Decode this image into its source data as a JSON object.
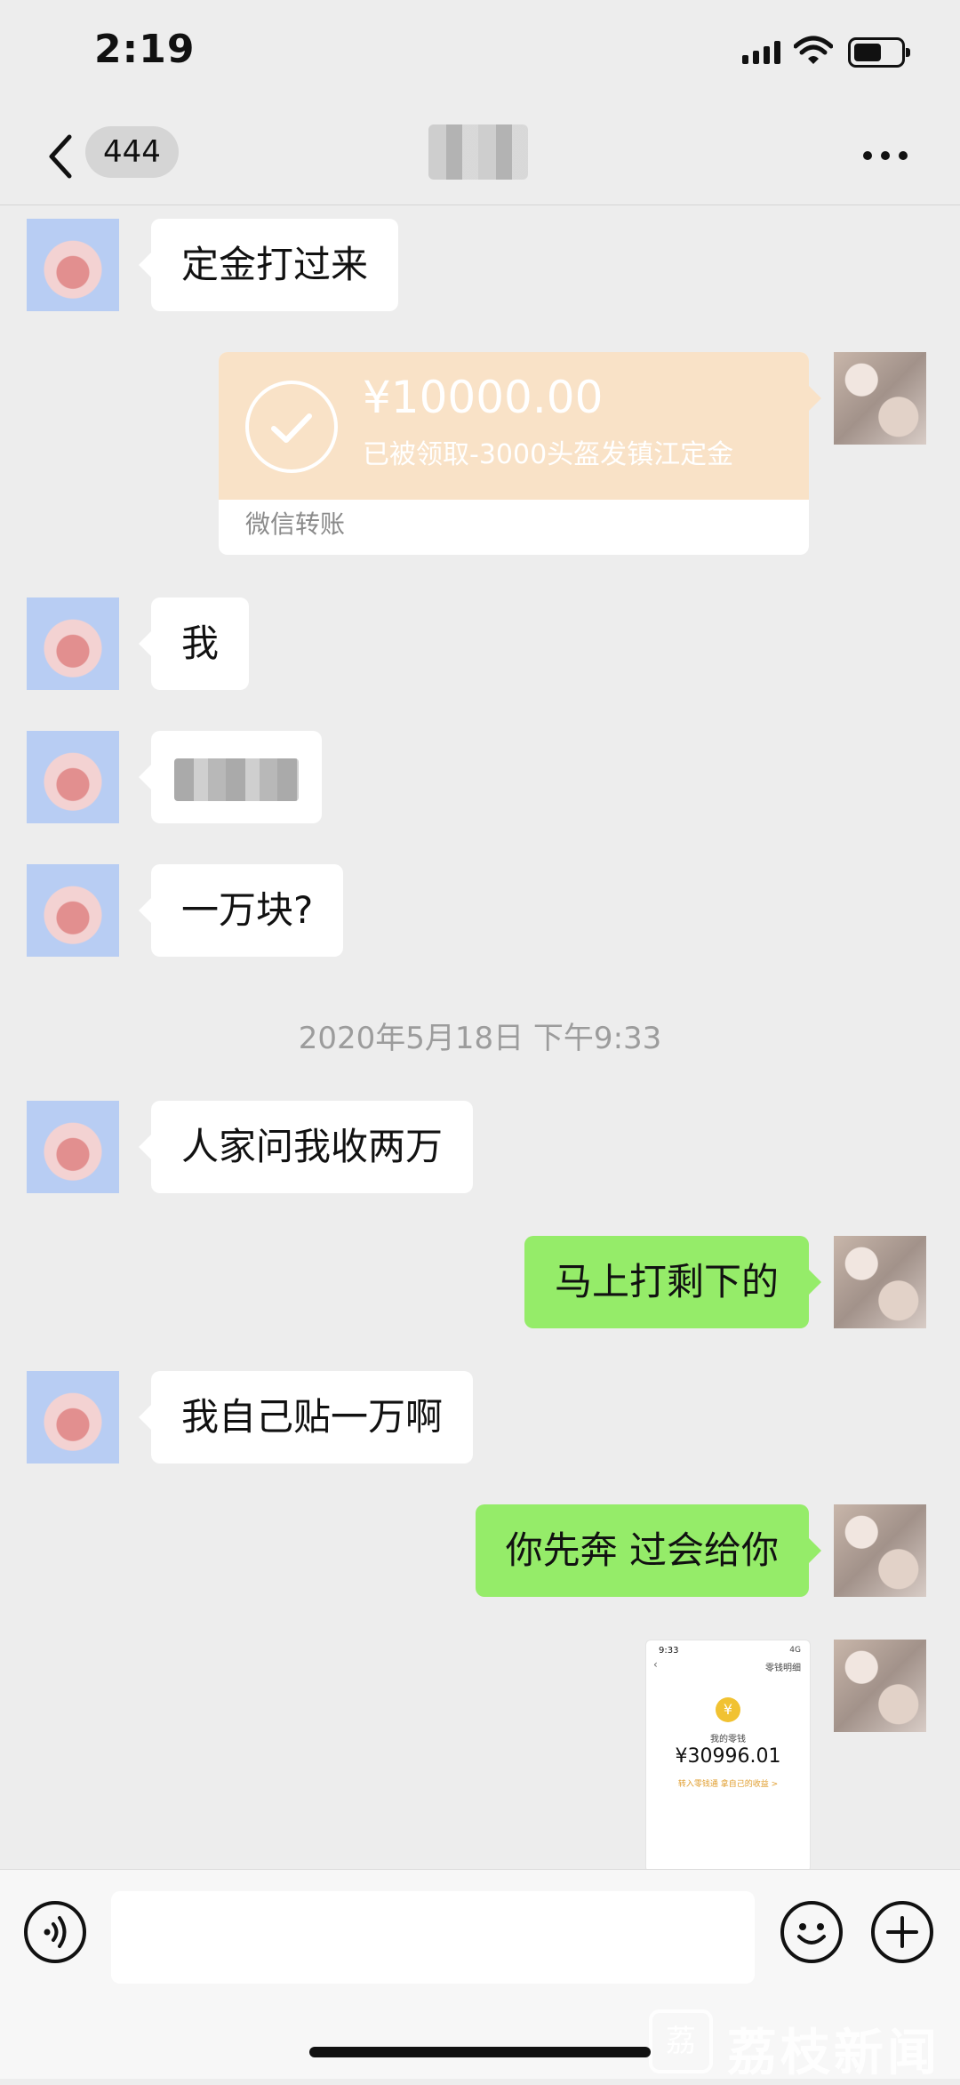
{
  "status_bar": {
    "time": "2:19"
  },
  "nav": {
    "unread_count": "444"
  },
  "transfer": {
    "amount": "¥10000.00",
    "note": "已被领取-3000头盔发镇江定金",
    "label": "微信转账"
  },
  "messages": [
    {
      "side": "them",
      "text": "定金打过来"
    },
    {
      "side": "them",
      "text": "我"
    },
    {
      "side": "them",
      "text": "一万块?"
    },
    {
      "side": "them",
      "text": "人家问我收两万"
    },
    {
      "side": "me",
      "text": "马上打剩下的"
    },
    {
      "side": "them",
      "text": "我自己贴一万啊"
    },
    {
      "side": "me",
      "text": "你先奔 过会给你"
    }
  ],
  "timestamp": "2020年5月18日 下午9:33",
  "wallet_screenshot": {
    "time": "9:33",
    "status": "4G",
    "title": "零钱明细",
    "coin": "¥",
    "label": "我的零钱",
    "balance": "¥30996.01",
    "link": "转入零钱通 拿自己的收益 >"
  },
  "watermark": {
    "logo": "荔",
    "text": "荔枝新闻"
  },
  "colors": {
    "background": "#ededed",
    "sent_bubble": "#95ec69",
    "received_bubble": "#ffffff",
    "transfer": "#f9e2c7"
  }
}
